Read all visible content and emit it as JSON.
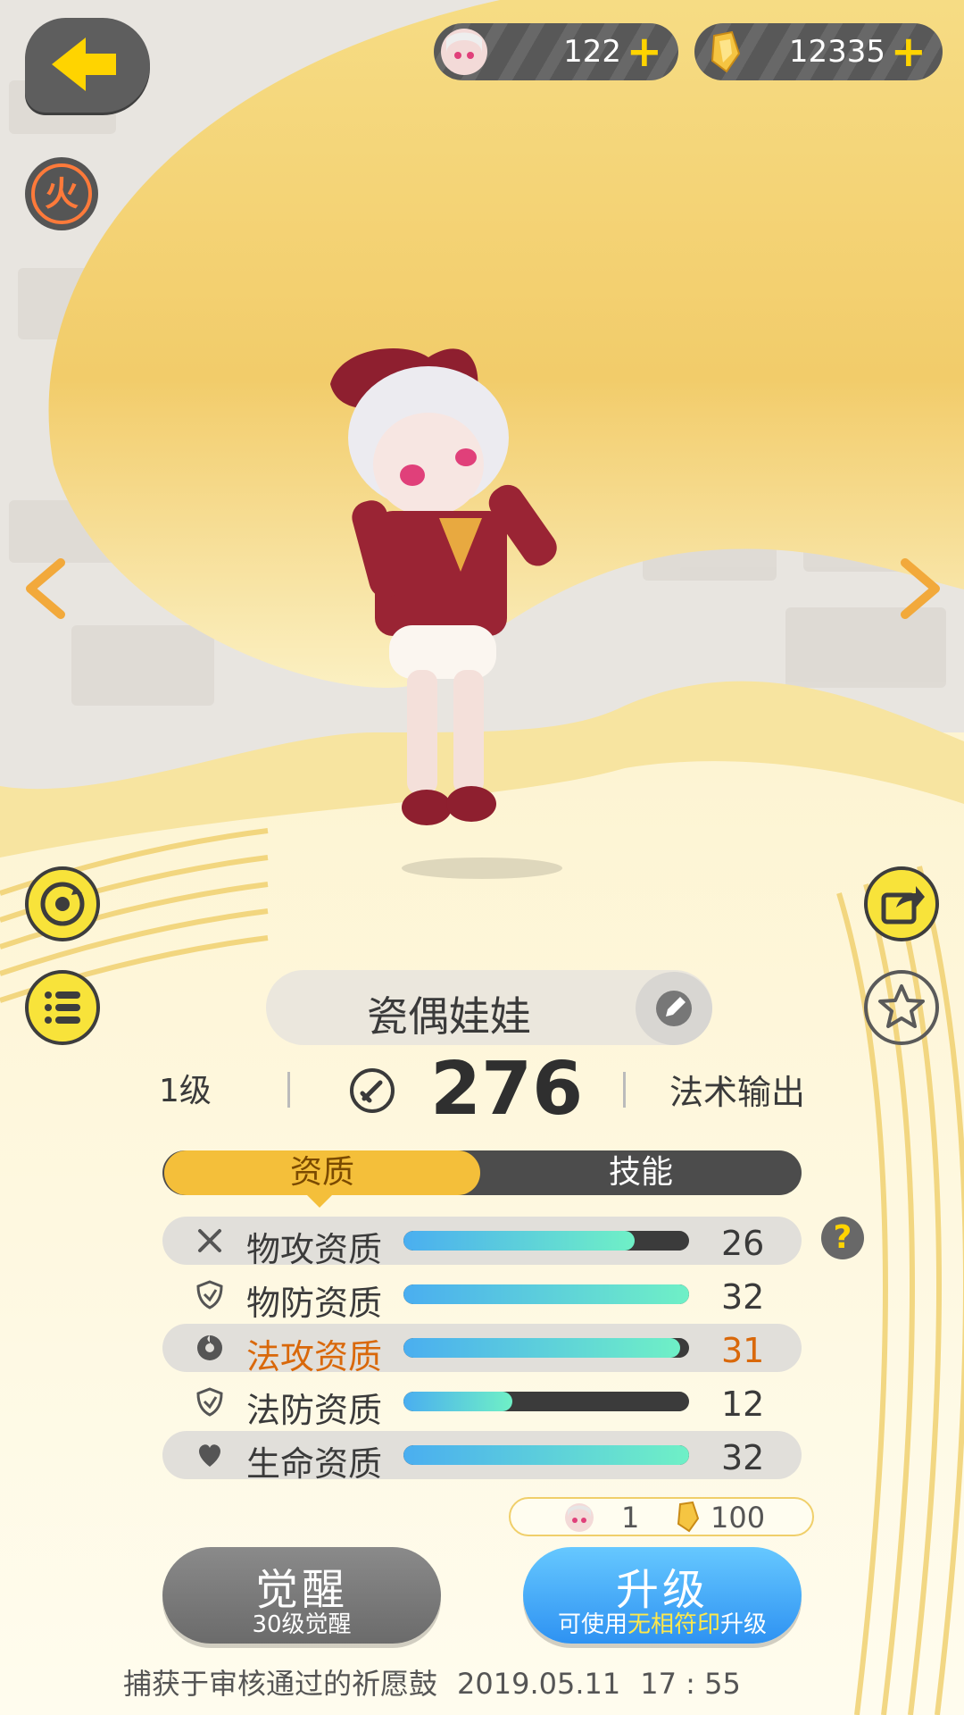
{
  "currency": {
    "ticket_count": "122",
    "gold_count": "12335"
  },
  "element_badge": "火",
  "pet": {
    "name": "瓷偶娃娃",
    "level": "1级",
    "power": "276",
    "role": "法术输出"
  },
  "tabs": [
    {
      "label": "资质",
      "active": true
    },
    {
      "label": "技能",
      "active": false
    }
  ],
  "attributes": [
    {
      "label": "物攻资质",
      "value": "26",
      "fill": 0.81,
      "icon": "sword-icon"
    },
    {
      "label": "物防资质",
      "value": "32",
      "fill": 1.0,
      "icon": "shield-icon"
    },
    {
      "label": "法攻资质",
      "value": "31",
      "fill": 0.97,
      "icon": "magic-icon",
      "highlight": true
    },
    {
      "label": "法防资质",
      "value": "12",
      "fill": 0.38,
      "icon": "shield-icon"
    },
    {
      "label": "生命资质",
      "value": "32",
      "fill": 1.0,
      "icon": "heart-icon"
    }
  ],
  "help_label": "?",
  "cost": {
    "ticket": "1",
    "gold": "100"
  },
  "buttons": {
    "awaken_main": "觉醒",
    "awaken_sub": "30级觉醒",
    "upgrade_main": "升级",
    "upgrade_sub_pre": "可使用",
    "upgrade_sub_hl": "无相符印",
    "upgrade_sub_post": "升级"
  },
  "footer": {
    "text": "捕获于审核通过的祈愿鼓",
    "date": "2019.05.11",
    "time": "17 : 55"
  },
  "colors": {
    "accent_yellow": "#f4bf3a",
    "highlight_orange": "#d9680a",
    "upgrade_blue": "#2e92f2"
  }
}
